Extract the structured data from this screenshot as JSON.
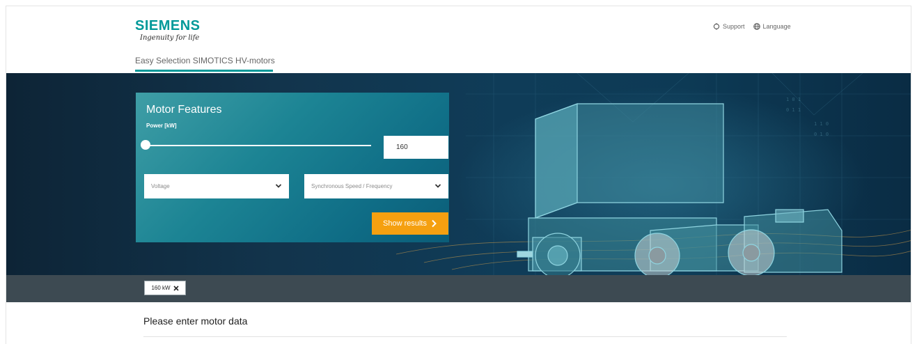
{
  "brand": {
    "name": "SIEMENS",
    "tagline": "Ingenuity for life",
    "color": "#009999"
  },
  "header": {
    "app_tab": "Easy Selection SIMOTICS HV-motors",
    "support_label": "Support",
    "language_label": "Language",
    "icons": [
      "support-icon",
      "globe-icon"
    ]
  },
  "panel": {
    "title": "Motor Features",
    "power_label": "Power [kW]",
    "power_value": "160",
    "voltage_placeholder": "Voltage",
    "speed_placeholder": "Synchronous Speed / Frequency",
    "show_results_label": "Show results",
    "accent": "#f5a010"
  },
  "filters": {
    "chips": [
      {
        "label": "160 kW"
      }
    ]
  },
  "message": "Please enter motor data"
}
